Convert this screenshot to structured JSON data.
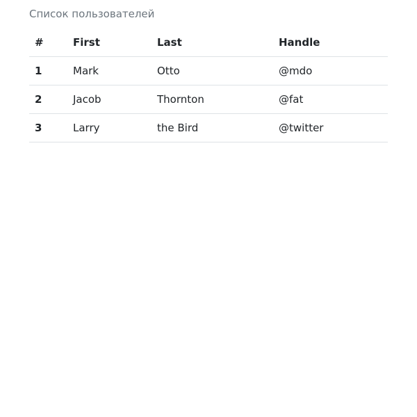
{
  "table": {
    "caption": "Список пользователей",
    "headers": [
      "#",
      "First",
      "Last",
      "Handle"
    ],
    "rows": [
      {
        "num": "1",
        "first": "Mark",
        "last": "Otto",
        "handle": "@mdo"
      },
      {
        "num": "2",
        "first": "Jacob",
        "last": "Thornton",
        "handle": "@fat"
      },
      {
        "num": "3",
        "first": "Larry",
        "last": "the Bird",
        "handle": "@twitter"
      }
    ]
  }
}
